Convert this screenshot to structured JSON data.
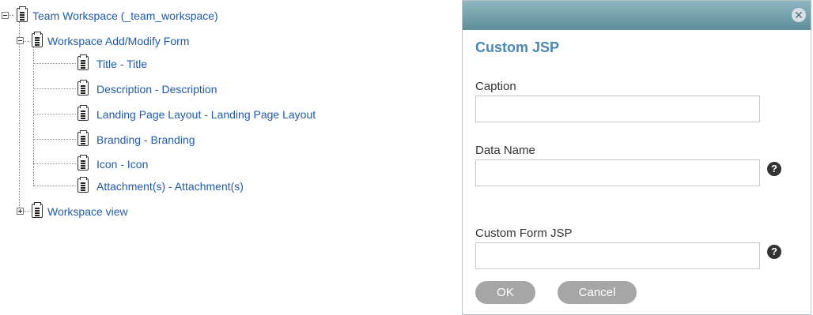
{
  "tree": {
    "root": {
      "label": "Team Workspace (_team_workspace)",
      "expanded": true,
      "icon": "document-icon"
    },
    "form": {
      "label": "Workspace Add/Modify Form",
      "expanded": true,
      "icon": "document-icon"
    },
    "fields": [
      {
        "label": "Title - Title"
      },
      {
        "label": "Description - Description"
      },
      {
        "label": "Landing Page Layout - Landing Page Layout"
      },
      {
        "label": "Branding - Branding"
      },
      {
        "label": "Icon - Icon"
      },
      {
        "label": "Attachment(s) - Attachment(s)"
      }
    ],
    "view": {
      "label": "Workspace view",
      "expanded": false,
      "icon": "document-icon"
    }
  },
  "dialog": {
    "title": "Custom JSP",
    "close_icon": "close-icon",
    "fields": {
      "caption": {
        "label": "Caption",
        "value": ""
      },
      "data_name": {
        "label": "Data Name",
        "value": "",
        "help_icon": "?"
      },
      "custom_form_jsp": {
        "label": "Custom Form JSP",
        "value": "",
        "help_icon": "?"
      }
    },
    "ok_label": "OK",
    "cancel_label": "Cancel",
    "close_glyph": "✕"
  },
  "colors": {
    "link": "#1f5aa6",
    "dialog_header": "#6e9ca8",
    "title": "#4a87b5",
    "button": "#a6a6a6"
  }
}
